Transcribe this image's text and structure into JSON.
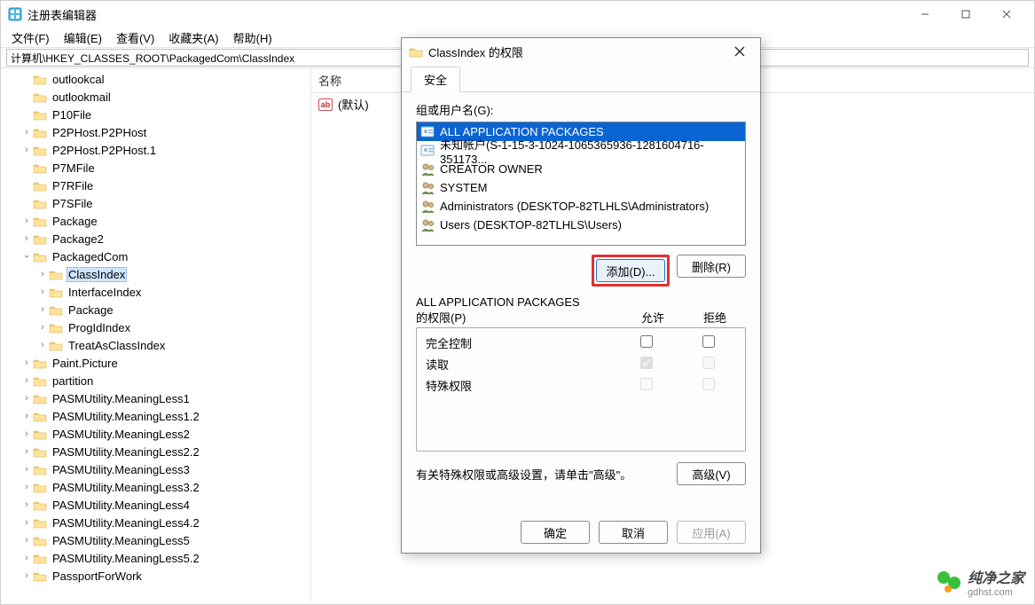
{
  "window": {
    "title": "注册表编辑器",
    "min_tip": "最小化",
    "max_tip": "最大化",
    "close_tip": "关闭"
  },
  "menu": {
    "file": "文件(F)",
    "edit": "编辑(E)",
    "view": "查看(V)",
    "fav": "收藏夹(A)",
    "help": "帮助(H)"
  },
  "address": "计算机\\HKEY_CLASSES_ROOT\\PackagedCom\\ClassIndex",
  "list": {
    "header_name": "名称",
    "row0": "(默认)"
  },
  "tree": {
    "items": [
      {
        "d": 1,
        "t": "",
        "label": "outlookcal"
      },
      {
        "d": 1,
        "t": "",
        "label": "outlookmail"
      },
      {
        "d": 1,
        "t": "",
        "label": "P10File"
      },
      {
        "d": 1,
        "t": ">",
        "label": "P2PHost.P2PHost"
      },
      {
        "d": 1,
        "t": ">",
        "label": "P2PHost.P2PHost.1"
      },
      {
        "d": 1,
        "t": "",
        "label": "P7MFile"
      },
      {
        "d": 1,
        "t": "",
        "label": "P7RFile"
      },
      {
        "d": 1,
        "t": "",
        "label": "P7SFile"
      },
      {
        "d": 1,
        "t": ">",
        "label": "Package"
      },
      {
        "d": 1,
        "t": ">",
        "label": "Package2"
      },
      {
        "d": 1,
        "t": "v",
        "label": "PackagedCom"
      },
      {
        "d": 2,
        "t": ">",
        "label": "ClassIndex",
        "sel": true
      },
      {
        "d": 2,
        "t": ">",
        "label": "InterfaceIndex"
      },
      {
        "d": 2,
        "t": ">",
        "label": "Package"
      },
      {
        "d": 2,
        "t": ">",
        "label": "ProgIdIndex"
      },
      {
        "d": 2,
        "t": ">",
        "label": "TreatAsClassIndex"
      },
      {
        "d": 1,
        "t": ">",
        "label": "Paint.Picture"
      },
      {
        "d": 1,
        "t": ">",
        "label": "partition"
      },
      {
        "d": 1,
        "t": ">",
        "label": "PASMUtility.MeaningLess1"
      },
      {
        "d": 1,
        "t": ">",
        "label": "PASMUtility.MeaningLess1.2"
      },
      {
        "d": 1,
        "t": ">",
        "label": "PASMUtility.MeaningLess2"
      },
      {
        "d": 1,
        "t": ">",
        "label": "PASMUtility.MeaningLess2.2"
      },
      {
        "d": 1,
        "t": ">",
        "label": "PASMUtility.MeaningLess3"
      },
      {
        "d": 1,
        "t": ">",
        "label": "PASMUtility.MeaningLess3.2"
      },
      {
        "d": 1,
        "t": ">",
        "label": "PASMUtility.MeaningLess4"
      },
      {
        "d": 1,
        "t": ">",
        "label": "PASMUtility.MeaningLess4.2"
      },
      {
        "d": 1,
        "t": ">",
        "label": "PASMUtility.MeaningLess5"
      },
      {
        "d": 1,
        "t": ">",
        "label": "PASMUtility.MeaningLess5.2"
      },
      {
        "d": 1,
        "t": ">",
        "label": "PassportForWork"
      }
    ]
  },
  "dialog": {
    "title": "ClassIndex 的权限",
    "tab_security": "安全",
    "group_label": "组或用户名(G):",
    "users": [
      {
        "name": "ALL APPLICATION PACKAGES",
        "sel": true,
        "type": "badge"
      },
      {
        "name": "未知帐户(S-1-15-3-1024-1065365936-1281604716-351173...",
        "type": "badge"
      },
      {
        "name": "CREATOR OWNER",
        "type": "people"
      },
      {
        "name": "SYSTEM",
        "type": "people"
      },
      {
        "name": "Administrators (DESKTOP-82TLHLS\\Administrators)",
        "type": "people"
      },
      {
        "name": "Users (DESKTOP-82TLHLS\\Users)",
        "type": "people"
      }
    ],
    "add_btn": "添加(D)...",
    "remove_btn": "删除(R)",
    "perm_label_line1": "ALL APPLICATION PACKAGES",
    "perm_label_line2": "的权限(P)",
    "col_allow": "允许",
    "col_deny": "拒绝",
    "perms": [
      {
        "name": "完全控制",
        "allow": false,
        "deny": false,
        "disabled": false
      },
      {
        "name": "读取",
        "allow": true,
        "deny": false,
        "disabled": true
      },
      {
        "name": "特殊权限",
        "allow": false,
        "deny": false,
        "disabled": true
      }
    ],
    "adv_text": "有关特殊权限或高级设置，请单击\"高级\"。",
    "adv_btn": "高级(V)",
    "ok": "确定",
    "cancel": "取消",
    "apply": "应用(A)"
  },
  "watermark": {
    "brand": "纯净之家",
    "url": "gdhst.com"
  }
}
